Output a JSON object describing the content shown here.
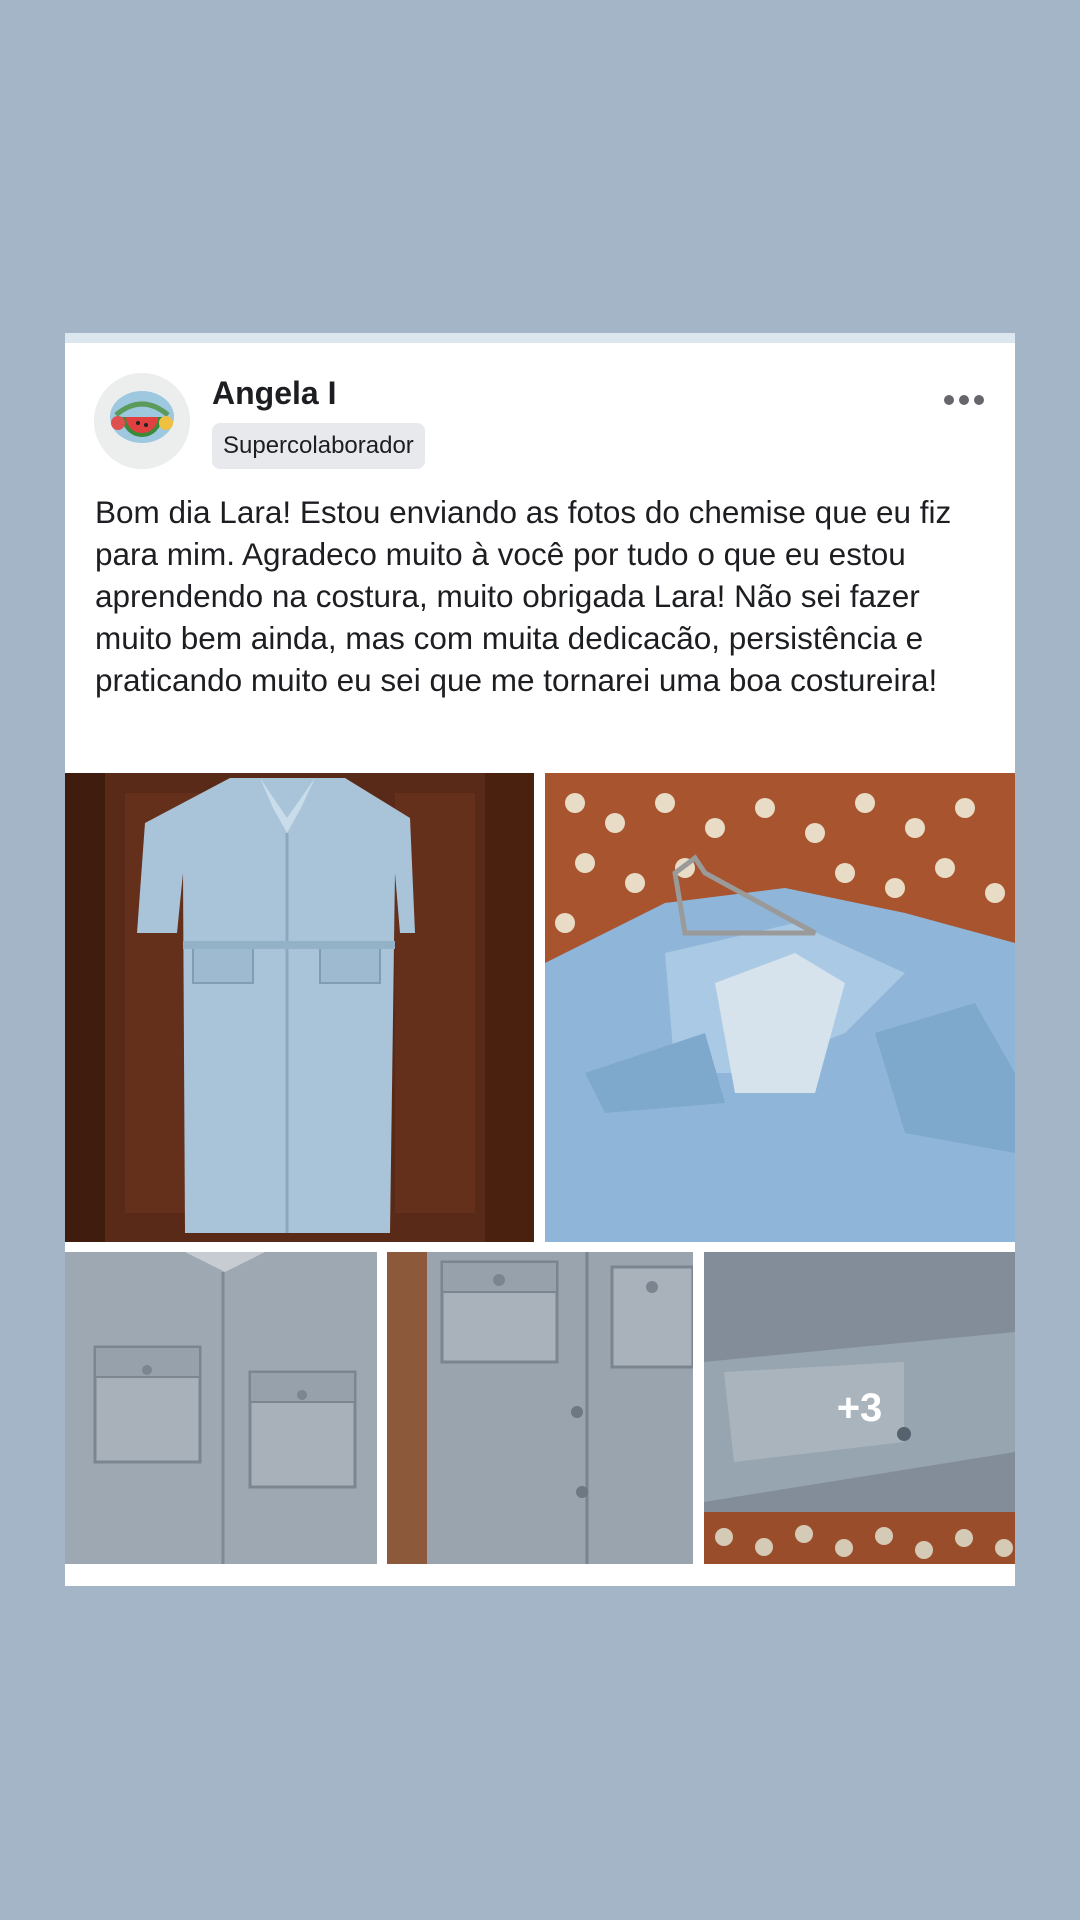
{
  "post": {
    "author": "Angela I",
    "badge": "Supercolaborador",
    "more_icon": "more-horizontal-icon",
    "text": "Bom dia Lara! Estou enviando as fotos do chemise que eu fiz para mim. Agradeco muito à você por tudo o que eu estou aprendendo na costura, muito obrigada Lara! Não sei fazer muito bem ainda, mas com muita dedicacão, persistência e praticando muito eu sei que me tornarei uma boa costureira!",
    "extra_photos_label": "+3"
  },
  "colors": {
    "background": "#a3b5c6",
    "card": "#ffffff",
    "badge": "#e7e9ec",
    "text": "#1c1e21"
  }
}
